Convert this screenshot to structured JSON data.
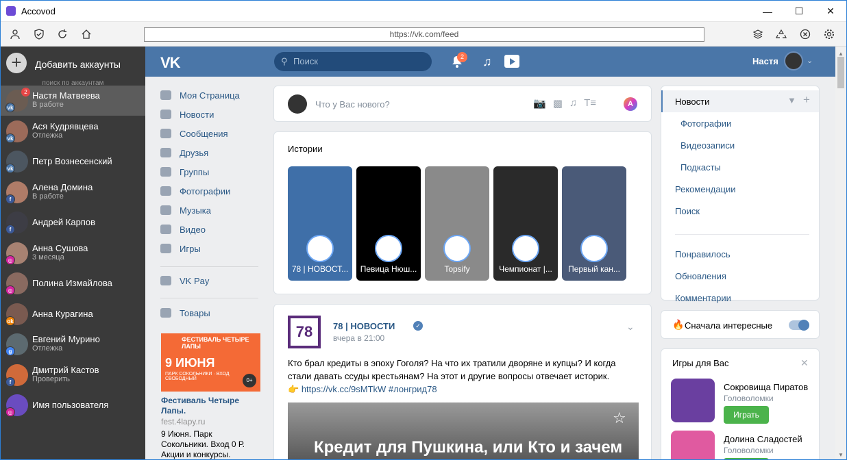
{
  "window": {
    "title": "Accovod"
  },
  "browser": {
    "url": "https://vk.com/feed"
  },
  "accounts": {
    "add_label": "Добавить аккаунты",
    "search_label": "поиск по аккаунтам",
    "items": [
      {
        "name": "Настя Матвеева",
        "status": "В работе",
        "network": "vk",
        "count": "2",
        "color": "#6b5c52"
      },
      {
        "name": "Ася Кудрявцева",
        "status": "Отлежка",
        "network": "vk",
        "count": "",
        "color": "#9c6b5a"
      },
      {
        "name": "Петр Вознесенский",
        "status": "",
        "network": "vk",
        "count": "",
        "color": "#4c5660"
      },
      {
        "name": "Алена Домина",
        "status": "В работе",
        "network": "facebook",
        "count": "",
        "color": "#b07c68"
      },
      {
        "name": "Андрей Карпов",
        "status": "",
        "network": "facebook",
        "count": "",
        "color": "#3d3d45"
      },
      {
        "name": "Анна Сушова",
        "status": "3 месяца",
        "network": "instagram",
        "count": "",
        "color": "#a88272"
      },
      {
        "name": "Полина Измайлова",
        "status": "",
        "network": "instagram",
        "count": "",
        "color": "#8a6a60"
      },
      {
        "name": "Анна Курагина",
        "status": "",
        "network": "odnoklassniki",
        "count": "",
        "color": "#7a5a50"
      },
      {
        "name": "Евгений Мурино",
        "status": "Отлежка",
        "network": "google",
        "count": "",
        "color": "#5c6a70"
      },
      {
        "name": "Дмитрий Кастов",
        "status": "Проверить",
        "network": "facebook",
        "count": "",
        "color": "#d06a3a"
      },
      {
        "name": "Имя пользователя",
        "status": "",
        "network": "instagram",
        "count": "",
        "color": "#6a4cc0"
      }
    ]
  },
  "vk": {
    "logo": "VK",
    "search_placeholder": "Поиск",
    "notifications_count": "2",
    "user_name": "Настя",
    "nav": [
      {
        "label": "Моя Страница",
        "icon": "home-icon"
      },
      {
        "label": "Новости",
        "icon": "news-icon"
      },
      {
        "label": "Сообщения",
        "icon": "messages-icon"
      },
      {
        "label": "Друзья",
        "icon": "friends-icon"
      },
      {
        "label": "Группы",
        "icon": "groups-icon"
      },
      {
        "label": "Фотографии",
        "icon": "camera-icon"
      },
      {
        "label": "Музыка",
        "icon": "music-icon"
      },
      {
        "label": "Видео",
        "icon": "video-icon"
      },
      {
        "label": "Игры",
        "icon": "gamepad-icon"
      },
      {
        "label": "VK Pay",
        "icon": "vkpay-icon"
      },
      {
        "label": "Товары",
        "icon": "bag-icon"
      }
    ],
    "ad": {
      "banner_title": "ФЕСТИВАЛЬ ЧЕТЫРЕ ЛАПЫ",
      "banner_date": "9 ИЮНЯ",
      "banner_sub": "ПАРК СОКОЛЬНИКИ · ВХОД СВОБОДНЫЙ",
      "age": "0+",
      "title": "Фестиваль Четыре Лапы.",
      "url": "fest.4lapy.ru",
      "description": "9 Июня. Парк Сокольники. Вход 0 Р. Акции и конкурсы."
    },
    "composer_placeholder": "Что у Вас нового?",
    "stories_title": "Истории",
    "stories": [
      {
        "label": "78 | НОВОСТ...",
        "bg": "#3f6fa8"
      },
      {
        "label": "Певица Нюш...",
        "bg": "#000000"
      },
      {
        "label": "Topsify",
        "bg": "#8a8a8a"
      },
      {
        "label": "Чемпионат |...",
        "bg": "#2a2a2a"
      },
      {
        "label": "Первый кан...",
        "bg": "#4a5a78"
      }
    ],
    "post": {
      "logo_text": "78",
      "author": "78 | НОВОСТИ",
      "time": "вчера в 21:00",
      "text": "Кто брал кредиты в эпоху Гоголя? На что их тратили дворяне и купцы? И когда стали давать ссуды крестьянам? На этот и другие вопросы отвечает историк.",
      "link": "https://vk.cc/9sMTkW #лонгрид78",
      "image_title": "Кредит для Пушкина, или Кто и зачем"
    },
    "right_menu": [
      {
        "label": "Новости",
        "kind": "active"
      },
      {
        "label": "Фотографии",
        "kind": "sub"
      },
      {
        "label": "Видеозаписи",
        "kind": "sub"
      },
      {
        "label": "Подкасты",
        "kind": "sub"
      },
      {
        "label": "Рекомендации",
        "kind": "main"
      },
      {
        "label": "Поиск",
        "kind": "main"
      },
      {
        "label": "Понравилось",
        "kind": "main"
      },
      {
        "label": "Обновления",
        "kind": "main"
      },
      {
        "label": "Комментарии",
        "kind": "main"
      }
    ],
    "interesting_first": "Сначала интересные",
    "interesting_toggle_on": true,
    "games_title": "Игры для Вас",
    "games": [
      {
        "name": "Сокровища Пиратов",
        "category": "Головоломки",
        "button": "Играть",
        "color": "#6a3fa0"
      },
      {
        "name": "Долина Сладостей",
        "category": "Головоломки",
        "button": "Играть",
        "color": "#e05aa0"
      }
    ]
  }
}
